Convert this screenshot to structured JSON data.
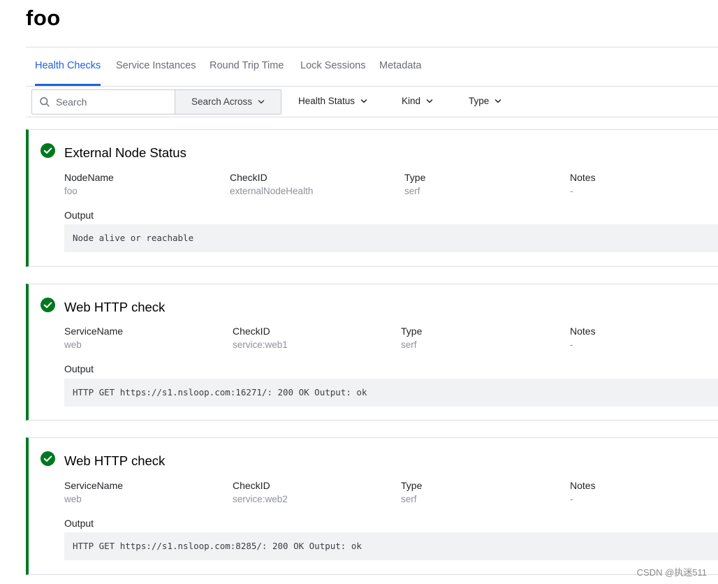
{
  "page": {
    "title": "foo"
  },
  "tabs": [
    {
      "label": "Health Checks",
      "active": true
    },
    {
      "label": "Service Instances",
      "active": false
    },
    {
      "label": "Round Trip Time",
      "active": false
    },
    {
      "label": "Lock Sessions",
      "active": false
    },
    {
      "label": "Metadata",
      "active": false
    }
  ],
  "filters": {
    "search_placeholder": "Search",
    "search_value": "",
    "search_across_label": "Search Across",
    "health_status_label": "Health Status",
    "kind_label": "Kind",
    "type_label": "Type"
  },
  "checks": [
    {
      "title": "External Node Status",
      "status": "passing",
      "fields": [
        {
          "label": "NodeName",
          "value": "foo"
        },
        {
          "label": "CheckID",
          "value": "externalNodeHealth"
        },
        {
          "label": "Type",
          "value": "serf"
        },
        {
          "label": "Notes",
          "value": "-"
        }
      ],
      "output_label": "Output",
      "output": "Node alive or reachable"
    },
    {
      "title": "Web HTTP check",
      "status": "passing",
      "fields": [
        {
          "label": "ServiceName",
          "value": "web"
        },
        {
          "label": "CheckID",
          "value": "service:web1"
        },
        {
          "label": "Type",
          "value": "serf"
        },
        {
          "label": "Notes",
          "value": "-"
        }
      ],
      "output_label": "Output",
      "output": "HTTP GET https://s1.nsloop.com:16271/: 200 OK Output: ok"
    },
    {
      "title": "Web HTTP check",
      "status": "passing",
      "fields": [
        {
          "label": "ServiceName",
          "value": "web"
        },
        {
          "label": "CheckID",
          "value": "service:web2"
        },
        {
          "label": "Type",
          "value": "serf"
        },
        {
          "label": "Notes",
          "value": "-"
        }
      ],
      "output_label": "Output",
      "output": "HTTP GET https://s1.nsloop.com:8285/: 200 OK Output: ok"
    }
  ],
  "colors": {
    "accent": "#1f62e0",
    "passing": "#00781e",
    "muted_text": "#8e9199",
    "output_bg": "#f1f2f3"
  },
  "icons": {
    "search": "search-icon",
    "chevron": "chevron-down-icon",
    "status_passing": "check-circle-icon"
  },
  "watermark": "CSDN @执迷511"
}
